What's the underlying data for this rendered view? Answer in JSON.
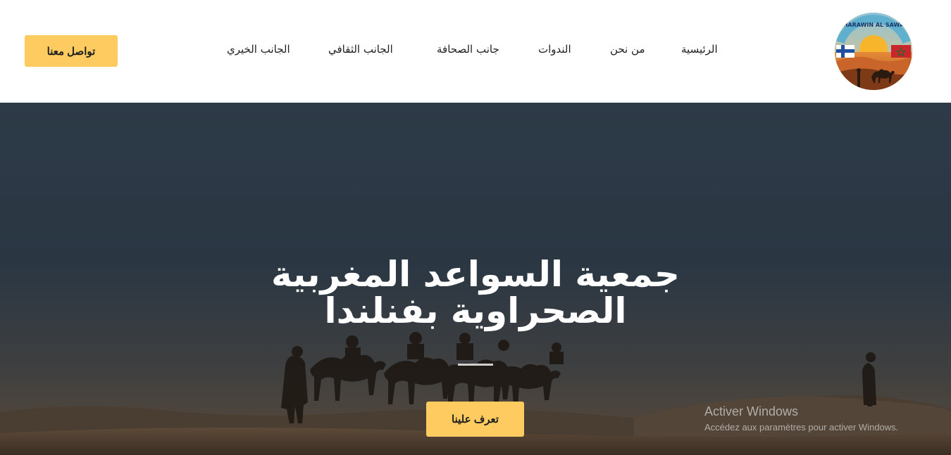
{
  "header": {
    "contact_button": "تواصل معنا",
    "nav": [
      {
        "label": "الرئيسية"
      },
      {
        "label": "من نحن"
      },
      {
        "label": "الندوات"
      },
      {
        "label": "جانب الصحافة"
      },
      {
        "label": "الجانب الثقافي"
      },
      {
        "label": "الجانب الخيري"
      }
    ],
    "logo": {
      "ring_text": "SAHARAWIN AL SAWAED",
      "flags": [
        "finland-flag",
        "morocco-flag"
      ]
    }
  },
  "hero": {
    "title_line1": "جمعية السواعد المغربية",
    "title_line2": "الصحراوية بفنلندا",
    "cta_button": "تعرف علينا"
  },
  "watermark": {
    "title": "Activer Windows",
    "subtitle": "Accédez aux paramètres pour activer Windows."
  },
  "colors": {
    "accent": "#fecb61",
    "text_dark": "#1e1e1e",
    "hero_overlay": "#2e3d4a"
  }
}
